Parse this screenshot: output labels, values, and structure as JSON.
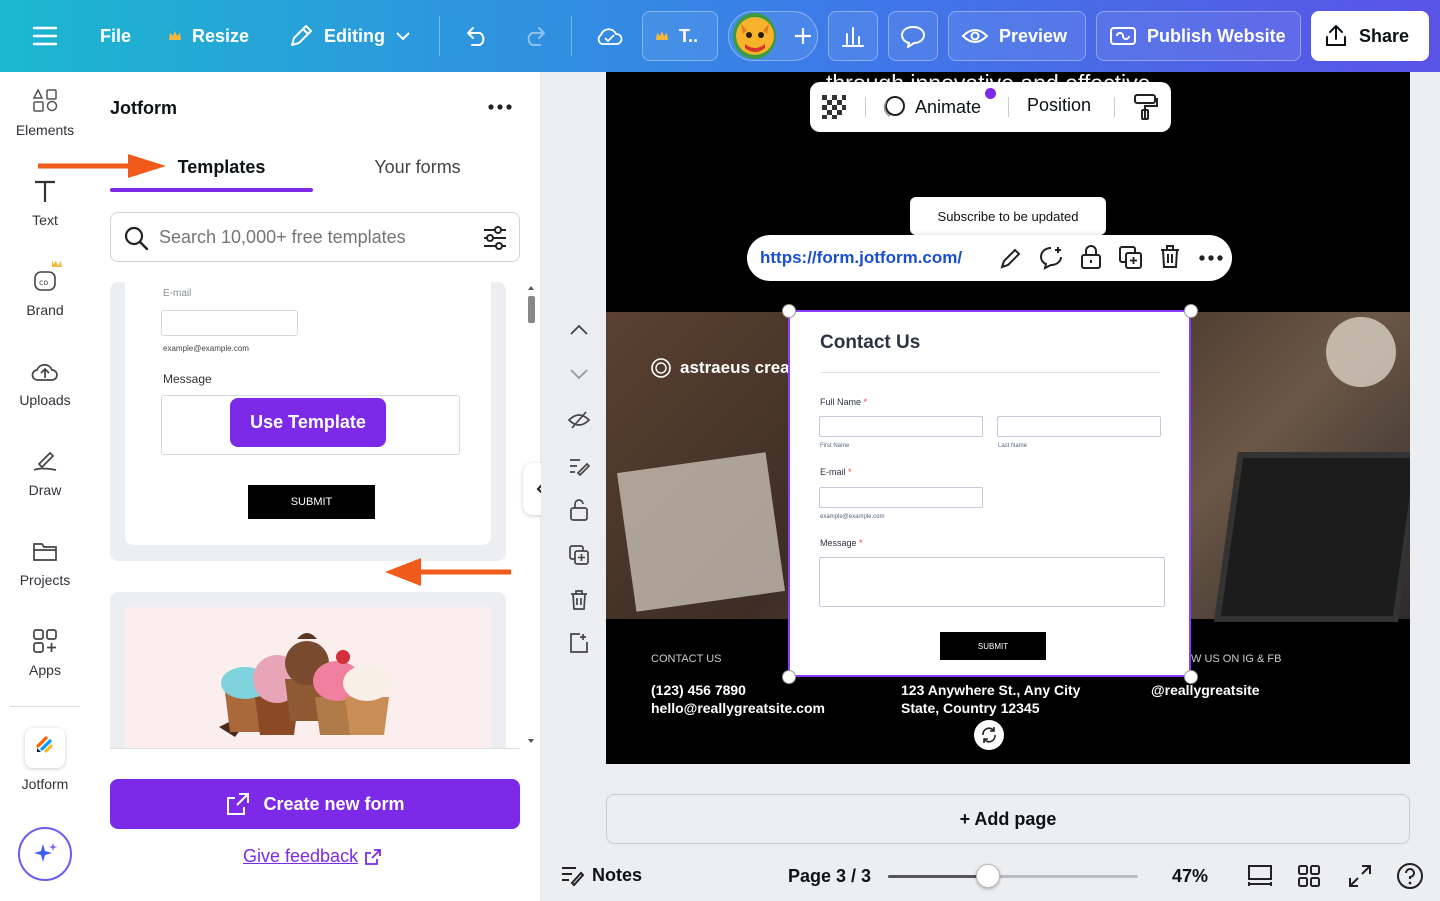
{
  "topbar": {
    "menu_icon": "hamburger-icon",
    "file": "File",
    "resize": "Resize",
    "editing": "Editing",
    "title_short": "T..",
    "preview": "Preview",
    "publish": "Publish Website",
    "share": "Share"
  },
  "rail": {
    "items": [
      "Elements",
      "Text",
      "Brand",
      "Uploads",
      "Draw",
      "Projects",
      "Apps",
      "Jotform"
    ]
  },
  "panel": {
    "title": "Jotform",
    "tabs": [
      "Templates",
      "Your forms"
    ],
    "search_placeholder": "Search 10,000+ free templates",
    "template1": {
      "email_label": "E-mail",
      "email_hint": "example@example.com",
      "message_label": "Message",
      "use_template": "Use Template",
      "submit": "SUBMIT"
    },
    "create_form": "Create new form",
    "feedback": "Give feedback"
  },
  "context_toolbar": {
    "animate": "Animate",
    "position": "Position"
  },
  "tooltip": "Subscribe to be updated",
  "link_bar": {
    "url": "https://form.jotform.com/"
  },
  "design": {
    "top_text": "through innovative and effective",
    "brand": "astraeus creat",
    "contact_heading": "CONTACT US",
    "phone": "(123) 456 7890",
    "email": "hello@reallygreatsite.com",
    "address1": "123 Anywhere St., Any City",
    "address2": "State, Country 12345",
    "follow_heading": "W US ON IG & FB",
    "handle": "@reallygreatsite"
  },
  "form": {
    "title": "Contact Us",
    "full_name": "Full Name",
    "first": "First Name",
    "last": "Last Name",
    "email": "E-mail",
    "email_hint": "example@example.com",
    "message": "Message",
    "submit": "SUBMIT"
  },
  "add_page": "+ Add page",
  "footer": {
    "notes": "Notes",
    "page": "Page 3 / 3",
    "zoom": "47%",
    "zoom_level": 0.47
  },
  "colors": {
    "accent": "#7d2ae8",
    "arrow": "#f05a1a"
  }
}
